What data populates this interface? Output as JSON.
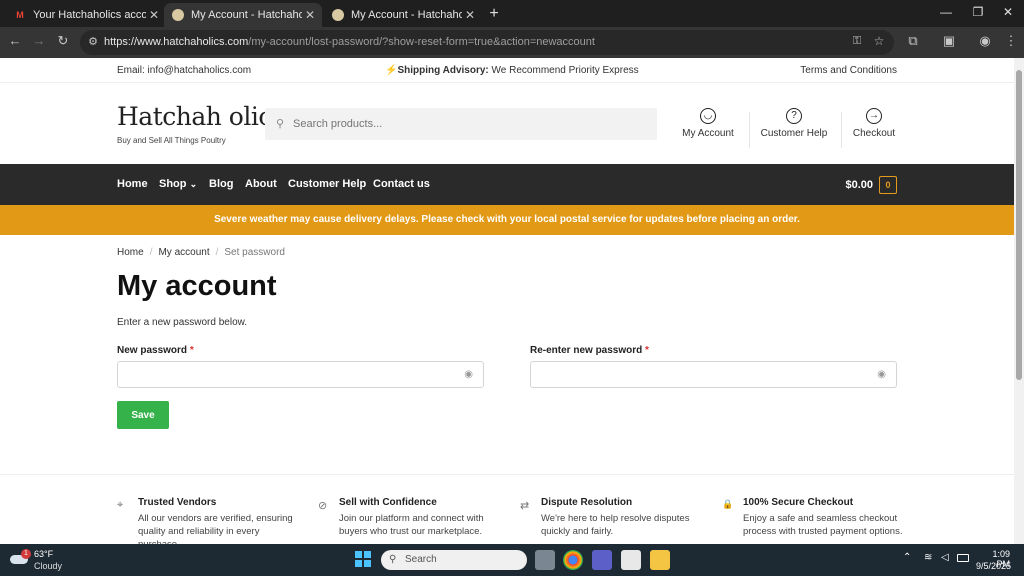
{
  "browser": {
    "tabs": [
      {
        "title": "Your Hatchaholics account has",
        "icon": "gmail-icon",
        "close": "✕"
      },
      {
        "title": "My Account - Hatchaholics",
        "icon": "site-favicon",
        "close": "✕"
      },
      {
        "title": "My Account - Hatchaholics",
        "icon": "site-favicon",
        "close": "✕"
      }
    ],
    "new_tab": "+",
    "url_host": "https://www.hatchaholics.com",
    "url_path": "/my-account/lost-password/?show-reset-form=true&action=newaccount",
    "window_controls": {
      "minimize": "—",
      "restore": "❐",
      "close": "✕"
    }
  },
  "topbar": {
    "email": "Email: info@hatchaholics.com",
    "advisory_icon": "⚡",
    "advisory_bold": "Shipping Advisory:",
    "advisory_text": " We Recommend Priority Express",
    "terms": "Terms and Conditions"
  },
  "header": {
    "logo": "Hatchah olics",
    "tagline": "Buy and Sell All Things Poultry",
    "search_placeholder": "Search products...",
    "links": [
      {
        "label": "My Account",
        "icon": "user-icon",
        "glyph": "◡"
      },
      {
        "label": "Customer Help",
        "icon": "help-icon",
        "glyph": "?"
      },
      {
        "label": "Checkout",
        "icon": "arrow-right-icon",
        "glyph": "→"
      }
    ]
  },
  "nav": {
    "items": [
      "Home",
      "Shop",
      "Blog",
      "About",
      "Customer Help",
      "Contact us"
    ],
    "shop_caret": "⌄",
    "cart_total": "$0.00",
    "cart_count": "0"
  },
  "notice": "Severe weather may cause delivery delays. Please check with your local postal service for updates before placing an order.",
  "breadcrumb": {
    "home": "Home",
    "account": "My account",
    "current": "Set password",
    "sep": "/"
  },
  "main": {
    "title": "My account",
    "intro": "Enter a new password below.",
    "new_password_label": "New password",
    "reenter_label": "Re-enter new password",
    "required_mark": "*",
    "save_label": "Save"
  },
  "features": [
    {
      "title": "Trusted Vendors",
      "desc": "All our vendors are verified, ensuring quality and reliability in every purchase.",
      "icon": "location-pin-icon",
      "glyph": "⌖"
    },
    {
      "title": "Sell with Confidence",
      "desc": "Join our platform and connect with buyers who trust our marketplace.",
      "icon": "globe-icon",
      "glyph": "⊘"
    },
    {
      "title": "Dispute Resolution",
      "desc": "We're here to help resolve disputes quickly and fairly.",
      "icon": "exchange-icon",
      "glyph": "⇄"
    },
    {
      "title": "100% Secure Checkout",
      "desc": "Enjoy a safe and seamless checkout process with trusted payment options.",
      "icon": "lock-icon",
      "glyph": "🔒"
    }
  ],
  "taskbar": {
    "weather_temp": "63°F",
    "weather_desc": "Cloudy",
    "weather_badge": "1",
    "search_label": "Search",
    "time": "1:09 PM",
    "date": "9/5/2025"
  }
}
